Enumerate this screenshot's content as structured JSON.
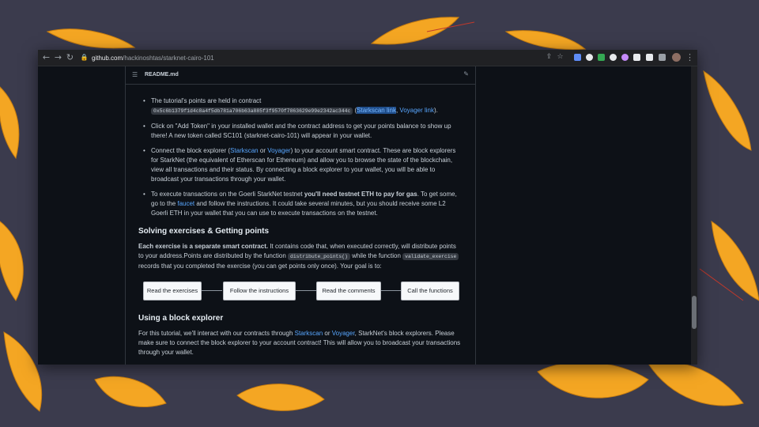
{
  "browser": {
    "url_host": "github.com",
    "url_path": "/hackinoshtas/starknet-cairo-101",
    "extensions": [
      "#5e8cf7",
      "#e8eaed",
      "#34a853",
      "#e8eaed",
      "#c58af9",
      "#e8eaed",
      "#e8eaed"
    ]
  },
  "readme": {
    "filename": "README.md"
  },
  "content": {
    "b1_text": "The tutorial's points are held in contract",
    "b1_address": "0x5c6b1379f1d4c8a4f5db781a706b63a885f3f9570f7863629e99e2342ac344c",
    "b1_open": " (",
    "b1_starkscan": "Starkscan link",
    "b1_comma": ", ",
    "b1_voyager": "Voyager link",
    "b1_close": ").",
    "b2_text": "Click on \"Add Token\" in your installed wallet and the contract address to get your points balance to show up there! A new token called SC101 (starknet-cairo-101) will appear in your wallet.",
    "b3_pre": "Connect the block explorer (",
    "b3_starkscan": "Starkscan",
    "b3_or": " or ",
    "b3_voyager": "Voyager",
    "b3_post": ") to your account smart contract. These are block explorers for StarkNet (the equivalent of Etherscan for Ethereum) and allow you to browse the state of the blockchain, view all transactions and their status. By connecting a block explorer to your wallet, you will be able to broadcast your transactions through your wallet.",
    "b4_pre": "To execute transactions on the Goerli StarkNet testnet ",
    "b4_bold": "you'll need testnet ETH to pay for gas",
    "b4_mid": ". To get some, go to the ",
    "b4_faucet": "faucet",
    "b4_post": " and follow the instructions. It could take several minutes, but you should receive some L2 Goerli ETH in your wallet that you can use to execute transactions on the testnet.",
    "h_solving": "Solving exercises & Getting points",
    "p1_bold": "Each exercise is a separate smart contract.",
    "p1_a": " It contains code that, when executed correctly, will distribute points to your address.Points are distributed by the function ",
    "p1_code1": "distribute_points()",
    "p1_b": " while the function ",
    "p1_code2": "validate_exercise",
    "p1_c": " records that you completed the exercise (you can get points only once). Your goal is to:",
    "flow": [
      "Read the exercises",
      "Follow the instructions",
      "Read the comments",
      "Call the functions"
    ],
    "h_explorer": "Using a block explorer",
    "p2_a": "For this tutorial, we'll interact with our contracts through ",
    "p2_starkscan": "Starkscan",
    "p2_or": " or ",
    "p2_voyager": "Voyager",
    "p2_b": ", StarkNet's block explorers. Please make sure to connect the block explorer to your account contract! This will allow you to broadcast your transactions through your wallet."
  }
}
